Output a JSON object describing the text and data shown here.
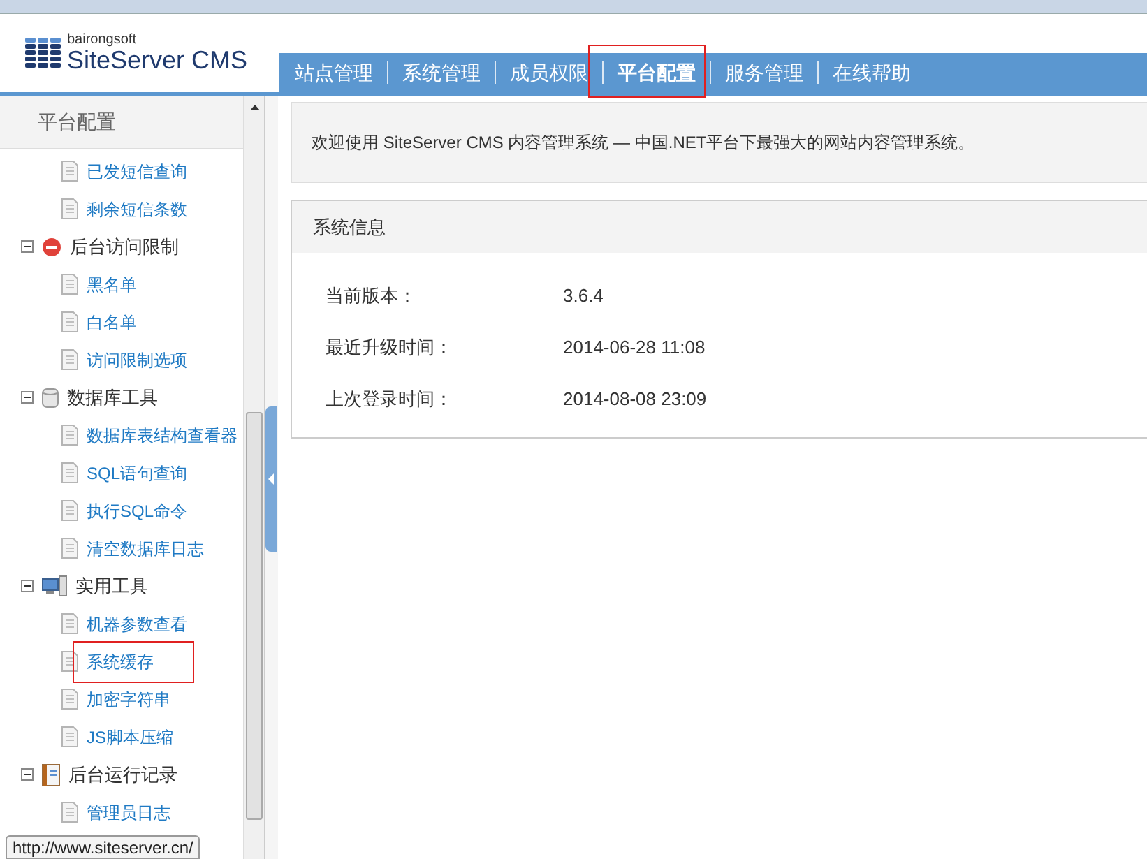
{
  "logo": {
    "brand": "bairongsoft",
    "product": "SiteServer CMS"
  },
  "nav": [
    {
      "label": "站点管理",
      "selected": false,
      "highlighted": false
    },
    {
      "label": "系统管理",
      "selected": false,
      "highlighted": false
    },
    {
      "label": "成员权限",
      "selected": false,
      "highlighted": false
    },
    {
      "label": "平台配置",
      "selected": true,
      "highlighted": true
    },
    {
      "label": "服务管理",
      "selected": false,
      "highlighted": false
    },
    {
      "label": "在线帮助",
      "selected": false,
      "highlighted": false
    }
  ],
  "sidebar": {
    "title": "平台配置",
    "leading_items": [
      {
        "label": "已发短信查询",
        "highlighted": false
      },
      {
        "label": "剩余短信条数",
        "highlighted": false
      }
    ],
    "groups": [
      {
        "label": "后台访问限制",
        "kind": "stop",
        "expanded": true,
        "children": [
          {
            "label": "黑名单",
            "highlighted": false
          },
          {
            "label": "白名单",
            "highlighted": false
          },
          {
            "label": "访问限制选项",
            "highlighted": false
          }
        ]
      },
      {
        "label": "数据库工具",
        "kind": "database",
        "expanded": true,
        "children": [
          {
            "label": "数据库表结构查看器",
            "highlighted": false
          },
          {
            "label": "SQL语句查询",
            "highlighted": false
          },
          {
            "label": "执行SQL命令",
            "highlighted": false
          },
          {
            "label": "清空数据库日志",
            "highlighted": false
          }
        ]
      },
      {
        "label": "实用工具",
        "kind": "computer",
        "expanded": true,
        "children": [
          {
            "label": "机器参数查看",
            "highlighted": false
          },
          {
            "label": "系统缓存",
            "highlighted": true
          },
          {
            "label": "加密字符串",
            "highlighted": false
          },
          {
            "label": "JS脚本压缩",
            "highlighted": false
          }
        ]
      },
      {
        "label": "后台运行记录",
        "kind": "log",
        "expanded": true,
        "children": [
          {
            "label": "管理员日志",
            "highlighted": false
          }
        ]
      }
    ]
  },
  "welcome": "欢迎使用 SiteServer CMS 内容管理系统 — 中国.NET平台下最强大的网站内容管理系统。",
  "info_panel": {
    "title": "系统信息",
    "rows": [
      {
        "label": "当前版本：",
        "value": "3.6.4"
      },
      {
        "label": "最近升级时间：",
        "value": "2014-06-28 11:08"
      },
      {
        "label": "上次登录时间：",
        "value": "2014-08-08 23:09"
      }
    ]
  },
  "status_tooltip": "http://www.siteserver.cn/"
}
